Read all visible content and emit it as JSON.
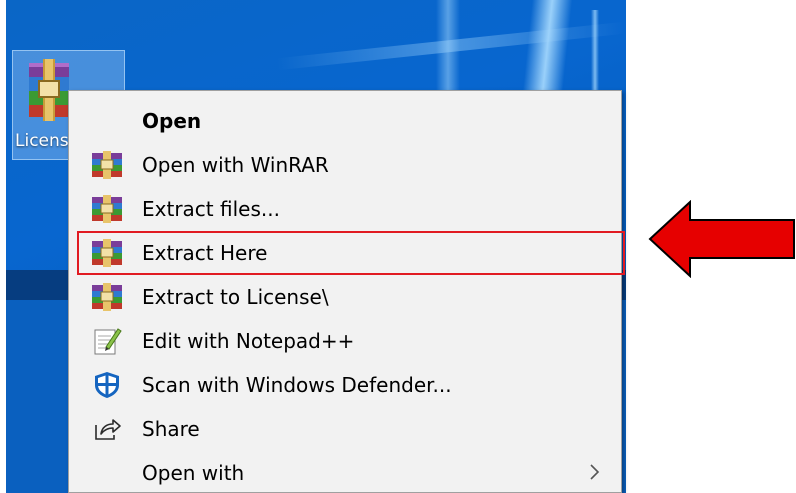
{
  "desktop": {
    "icon_label": "Licens"
  },
  "context_menu": {
    "items": [
      {
        "label": "Open",
        "icon": "none",
        "bold": true
      },
      {
        "label": "Open with WinRAR",
        "icon": "winrar-icon"
      },
      {
        "label": "Extract files...",
        "icon": "winrar-icon"
      },
      {
        "label": "Extract Here",
        "icon": "winrar-icon",
        "highlighted": true
      },
      {
        "label": "Extract to License\\",
        "icon": "winrar-icon"
      },
      {
        "label": "Edit with Notepad++",
        "icon": "notepad-plus-plus-icon"
      },
      {
        "label": "Scan with Windows Defender...",
        "icon": "windows-defender-shield-icon"
      },
      {
        "label": "Share",
        "icon": "share-icon"
      },
      {
        "label": "Open with",
        "icon": "none",
        "submenu": true
      }
    ]
  },
  "annotation": {
    "arrow_color": "#e60000",
    "highlight_color": "#e11b22"
  }
}
